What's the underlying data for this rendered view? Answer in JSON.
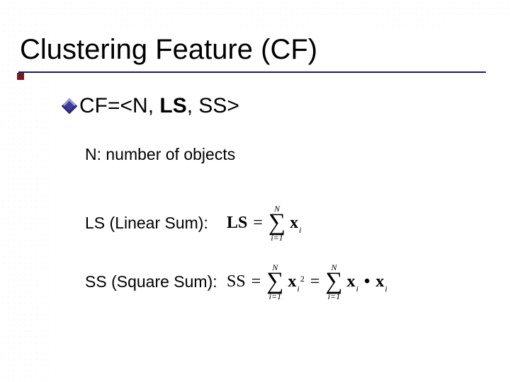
{
  "title": "Clustering Feature (CF)",
  "cf": {
    "prefix": "CF=<N, ",
    "bold": "LS",
    "suffix": ", SS>"
  },
  "defs": {
    "n": "N: number of objects",
    "ls_bold": "LS",
    "ls_rest": " (Linear Sum):",
    "ss": "SS (Square Sum):"
  },
  "formulas": {
    "ls": {
      "lhs": "LS",
      "upper": "N",
      "lower": "i=1",
      "base": "x",
      "sub": "i"
    },
    "ss": {
      "lhs": "SS",
      "upper": "N",
      "lower": "i=1",
      "base": "x",
      "sub": "i",
      "sup": "2",
      "upper2": "N",
      "lower2": "i=1",
      "base2": "x",
      "sub2": "i"
    }
  }
}
